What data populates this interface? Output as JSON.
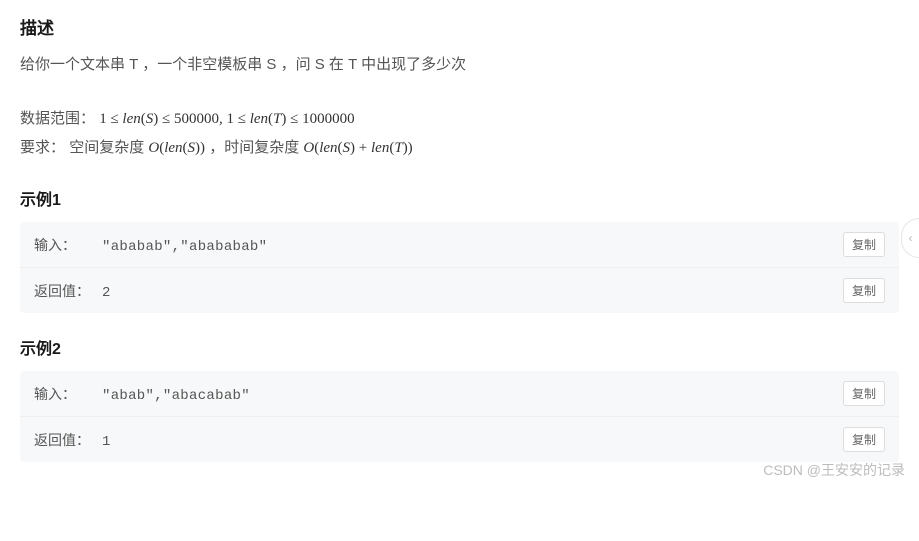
{
  "section_description": {
    "heading": "描述",
    "text": "给你一个文本串 T ，一个非空模板串 S ，问 S 在 T 中出现了多少次"
  },
  "constraints": {
    "data_range_label": "数据范围：",
    "data_range_formula": "1 ≤ len(S) ≤ 500000, 1 ≤ len(T) ≤ 1000000",
    "requirement_label": "要求：",
    "space_label": "空间复杂度 ",
    "space_formula": "O(len(S))",
    "time_link": "，时间复杂度 ",
    "time_formula": "O(len(S) + len(T))"
  },
  "examples": [
    {
      "heading": "示例1",
      "rows": [
        {
          "label": "输入：",
          "value": "\"ababab\",\"abababab\"",
          "copy": "复制"
        },
        {
          "label": "返回值：",
          "value": "2",
          "copy": "复制"
        }
      ]
    },
    {
      "heading": "示例2",
      "rows": [
        {
          "label": "输入：",
          "value": "\"abab\",\"abacabab\"",
          "copy": "复制"
        },
        {
          "label": "返回值：",
          "value": "1",
          "copy": "复制"
        }
      ]
    }
  ],
  "watermark": "CSDN @王安安的记录",
  "scroll_hint": "‹"
}
